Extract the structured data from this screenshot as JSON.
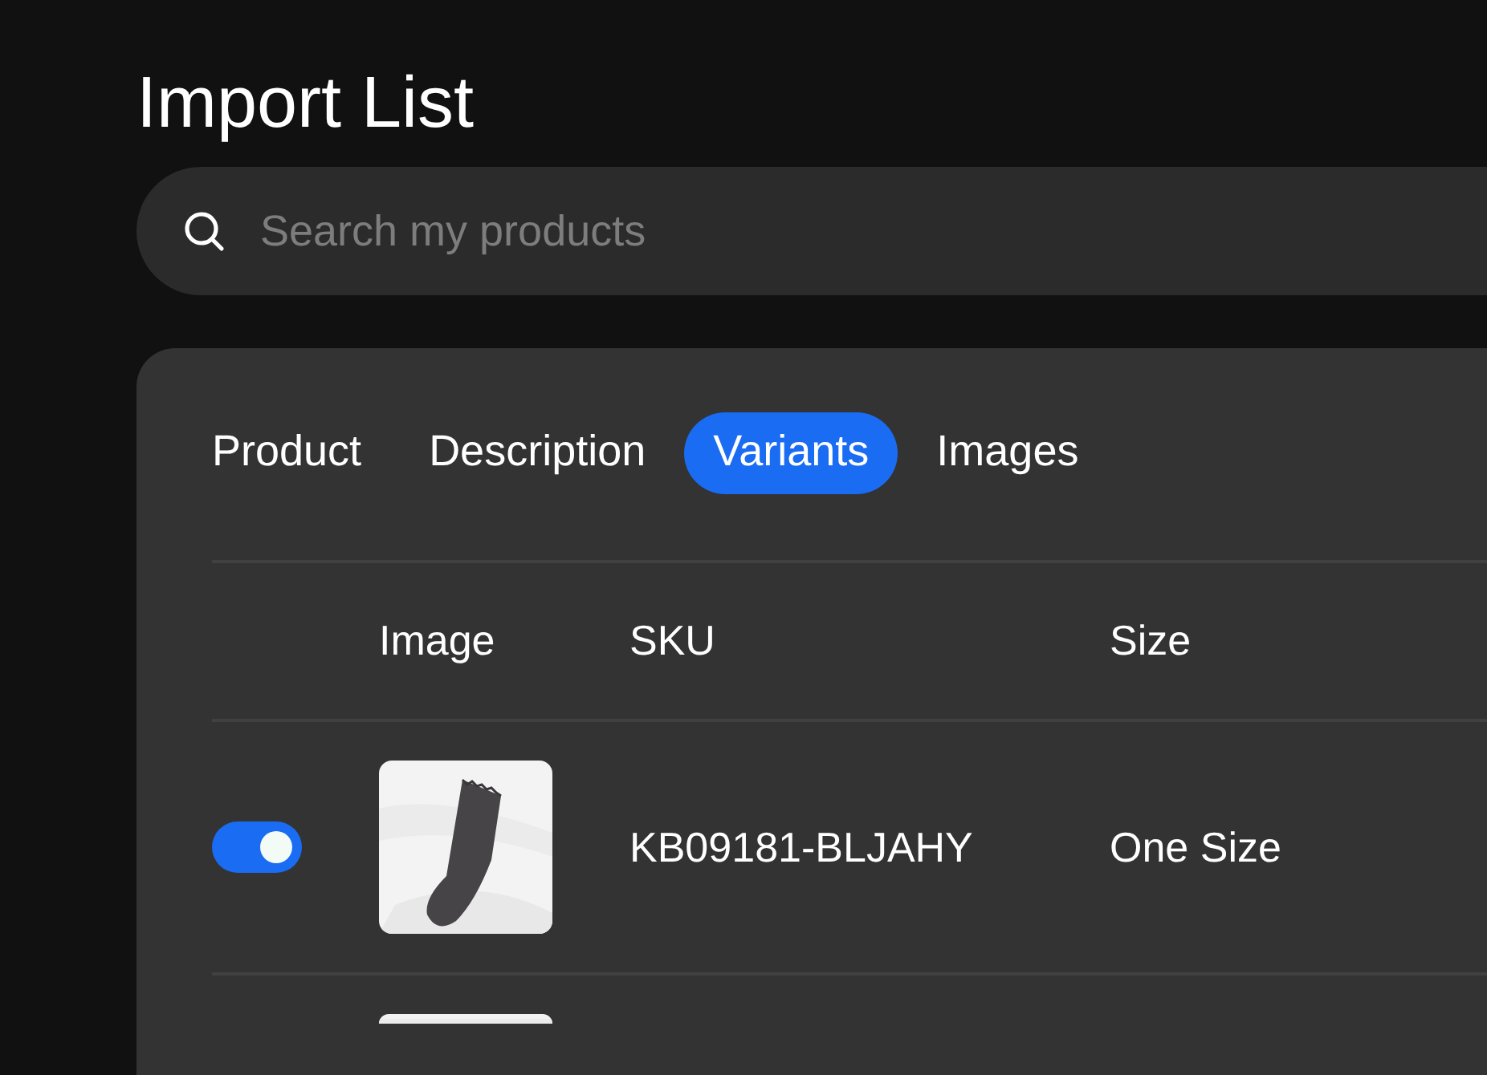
{
  "title": "Import List",
  "search": {
    "placeholder": "Search my products"
  },
  "tabs": [
    {
      "label": "Product",
      "selected": false
    },
    {
      "label": "Description",
      "selected": false
    },
    {
      "label": "Variants",
      "selected": true
    },
    {
      "label": "Images",
      "selected": false
    }
  ],
  "table": {
    "columns": [
      "Image",
      "SKU",
      "Size"
    ],
    "rows": [
      {
        "kind": "full",
        "enabled": true,
        "sku": "KB09181-BLJAHY",
        "size": "One Size"
      },
      {
        "kind": "partial"
      }
    ]
  }
}
